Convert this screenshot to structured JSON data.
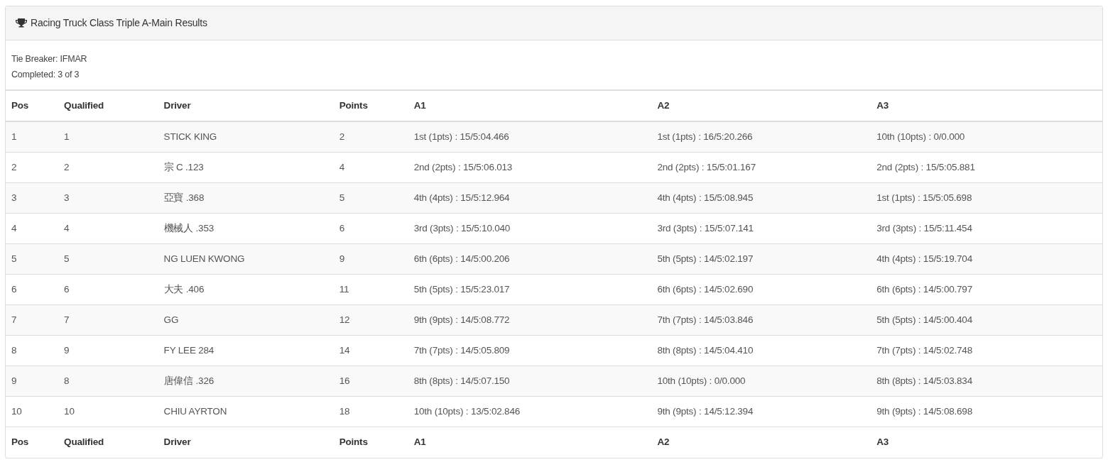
{
  "panel": {
    "title": "Racing Truck Class Triple A-Main Results"
  },
  "info": [
    "Tie Breaker: IFMAR",
    "Completed: 3 of 3"
  ],
  "table": {
    "columns": [
      "Pos",
      "Qualified",
      "Driver",
      "Points",
      "A1",
      "A2",
      "A3"
    ],
    "rows": [
      [
        "1",
        "1",
        "STICK KING",
        "2",
        "1st (1pts) : 15/5:04.466",
        "1st (1pts) : 16/5:20.266",
        "10th (10pts) : 0/0.000"
      ],
      [
        "2",
        "2",
        "宗 C .123",
        "4",
        "2nd (2pts) : 15/5:06.013",
        "2nd (2pts) : 15/5:01.167",
        "2nd (2pts) : 15/5:05.881"
      ],
      [
        "3",
        "3",
        "亞寶 .368",
        "5",
        "4th (4pts) : 15/5:12.964",
        "4th (4pts) : 15/5:08.945",
        "1st (1pts) : 15/5:05.698"
      ],
      [
        "4",
        "4",
        "機械人 .353",
        "6",
        "3rd (3pts) : 15/5:10.040",
        "3rd (3pts) : 15/5:07.141",
        "3rd (3pts) : 15/5:11.454"
      ],
      [
        "5",
        "5",
        "NG LUEN KWONG",
        "9",
        "6th (6pts) : 14/5:00.206",
        "5th (5pts) : 14/5:02.197",
        "4th (4pts) : 15/5:19.704"
      ],
      [
        "6",
        "6",
        "大夫 .406",
        "11",
        "5th (5pts) : 15/5:23.017",
        "6th (6pts) : 14/5:02.690",
        "6th (6pts) : 14/5:00.797"
      ],
      [
        "7",
        "7",
        "GG",
        "12",
        "9th (9pts) : 14/5:08.772",
        "7th (7pts) : 14/5:03.846",
        "5th (5pts) : 14/5:00.404"
      ],
      [
        "8",
        "9",
        "FY LEE 284",
        "14",
        "7th (7pts) : 14/5:05.809",
        "8th (8pts) : 14/5:04.410",
        "7th (7pts) : 14/5:02.748"
      ],
      [
        "9",
        "8",
        "唐偉信 .326",
        "16",
        "8th (8pts) : 14/5:07.150",
        "10th (10pts) : 0/0.000",
        "8th (8pts) : 14/5:03.834"
      ],
      [
        "10",
        "10",
        "CHIU AYRTON",
        "18",
        "10th (10pts) : 13/5:02.846",
        "9th (9pts) : 14/5:12.394",
        "9th (9pts) : 14/5:08.698"
      ]
    ],
    "footer_columns": [
      "Pos",
      "Qualified",
      "Driver",
      "Points",
      "A1",
      "A2",
      "A3"
    ]
  }
}
